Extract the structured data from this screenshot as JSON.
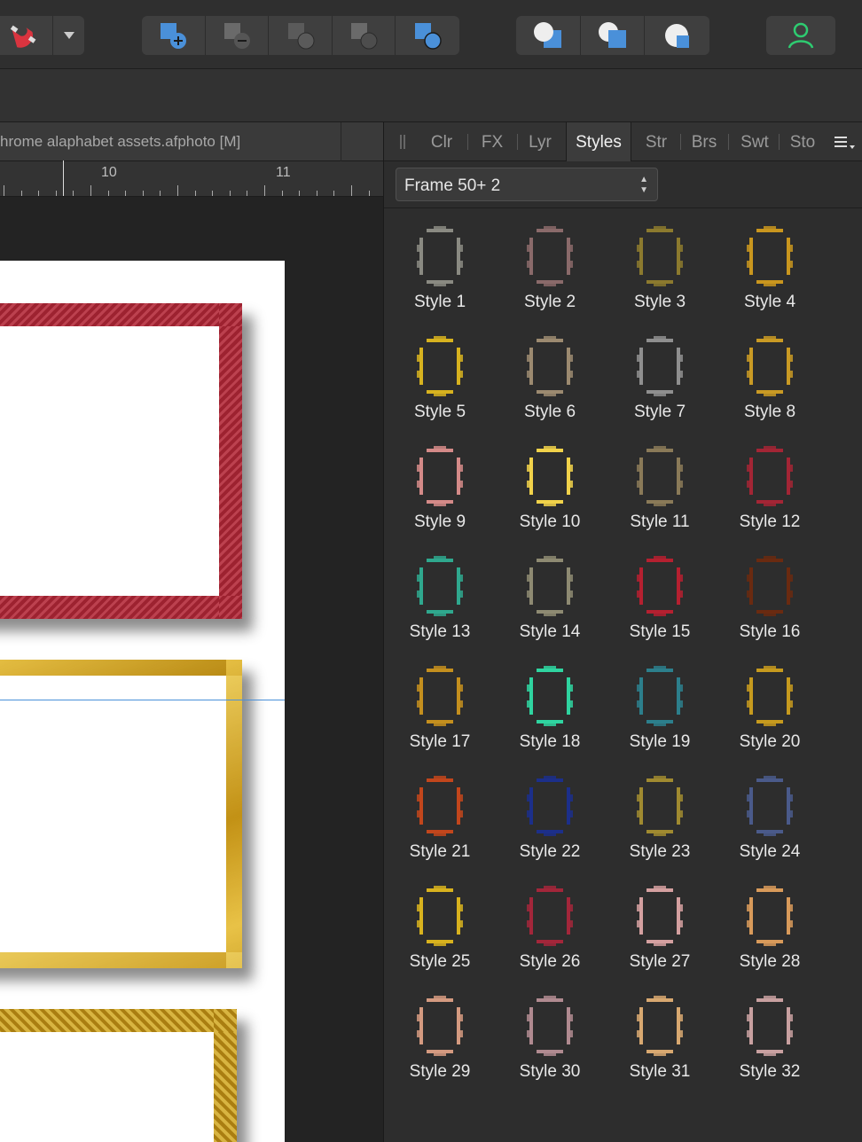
{
  "document": {
    "title": "hrome alaphabet assets.afphoto [M]"
  },
  "ruler": {
    "labels": [
      "10",
      "11"
    ]
  },
  "panel": {
    "tabs": [
      "Clr",
      "FX",
      "Lyr",
      "Styles",
      "Str",
      "Brs",
      "Swt",
      "Sto"
    ],
    "active_tab": "Styles",
    "category_selected": "Frame 50+ 2",
    "styles": [
      {
        "label": "Style 1",
        "color": "#8a8a82"
      },
      {
        "label": "Style 2",
        "color": "#8a6a6a"
      },
      {
        "label": "Style 3",
        "color": "#8c7a2e"
      },
      {
        "label": "Style 4",
        "color": "#c9961e"
      },
      {
        "label": "Style 5",
        "color": "#d7b21f"
      },
      {
        "label": "Style 6",
        "color": "#9c8a70"
      },
      {
        "label": "Style 7",
        "color": "#8f8f8f"
      },
      {
        "label": "Style 8",
        "color": "#c99a24"
      },
      {
        "label": "Style 9",
        "color": "#d48a88"
      },
      {
        "label": "Style 10",
        "color": "#f1d24a"
      },
      {
        "label": "Style 11",
        "color": "#8a7a58"
      },
      {
        "label": "Style 12",
        "color": "#a32535"
      },
      {
        "label": "Style 13",
        "color": "#2fa88e"
      },
      {
        "label": "Style 14",
        "color": "#8e8a72"
      },
      {
        "label": "Style 15",
        "color": "#b52030"
      },
      {
        "label": "Style 16",
        "color": "#6a2a10"
      },
      {
        "label": "Style 17",
        "color": "#c48f1e"
      },
      {
        "label": "Style 18",
        "color": "#2fd4a0"
      },
      {
        "label": "Style 19",
        "color": "#2c7f8c"
      },
      {
        "label": "Style 20",
        "color": "#c69a1e"
      },
      {
        "label": "Style 21",
        "color": "#c2461c"
      },
      {
        "label": "Style 22",
        "color": "#1c2f8a"
      },
      {
        "label": "Style 23",
        "color": "#a08a30"
      },
      {
        "label": "Style 24",
        "color": "#4a5a8a"
      },
      {
        "label": "Style 25",
        "color": "#d8b21e"
      },
      {
        "label": "Style 26",
        "color": "#a3263a"
      },
      {
        "label": "Style 27",
        "color": "#d4a0a0"
      },
      {
        "label": "Style 28",
        "color": "#d89a5a"
      },
      {
        "label": "Style 29",
        "color": "#d49a80"
      },
      {
        "label": "Style 30",
        "color": "#b08a90"
      },
      {
        "label": "Style 31",
        "color": "#d8a870"
      },
      {
        "label": "Style 32",
        "color": "#c8a0a0"
      }
    ]
  },
  "colors": {
    "accent_blue": "#4a90d9",
    "user_icon": "#2ecc71"
  }
}
